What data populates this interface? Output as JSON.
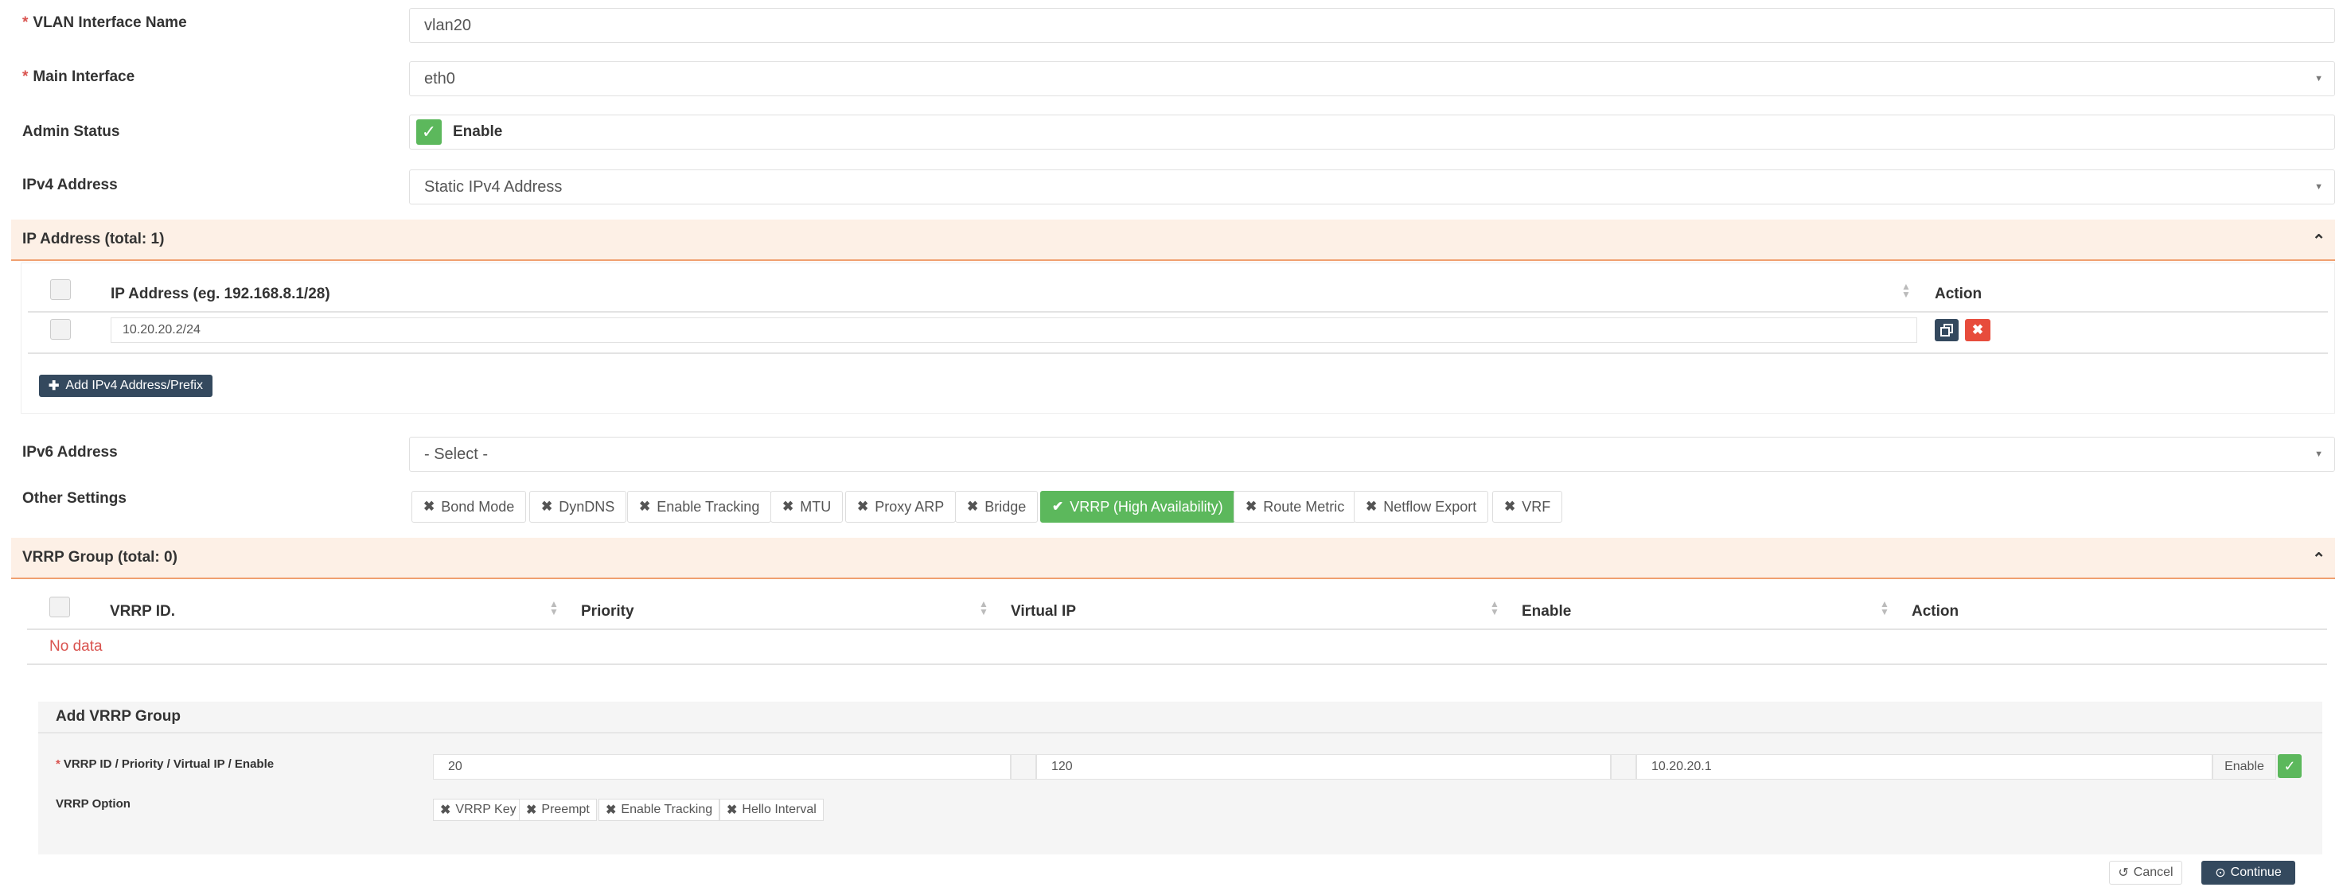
{
  "form": {
    "vlan_name_label": "VLAN Interface Name",
    "vlan_name_value": "vlan20",
    "main_interface_label": "Main Interface",
    "main_interface_value": "eth0",
    "admin_status_label": "Admin Status",
    "admin_status_value": "Enable",
    "ipv4_label": "IPv4 Address",
    "ipv4_value": "Static IPv4 Address",
    "ipv6_label": "IPv6 Address",
    "ipv6_value": "- Select -",
    "other_settings_label": "Other Settings",
    "required_mark": "*"
  },
  "ip_section": {
    "title": "IP Address (total: 1)",
    "col_ip": "IP Address (eg. 192.168.8.1/28)",
    "col_action": "Action",
    "rows": [
      {
        "ip": "10.20.20.2/24"
      }
    ],
    "add_button": "Add IPv4 Address/Prefix"
  },
  "other_settings": [
    {
      "label": "Bond Mode",
      "active": false
    },
    {
      "label": "DynDNS",
      "active": false
    },
    {
      "label": "Enable Tracking",
      "active": false
    },
    {
      "label": "MTU",
      "active": false
    },
    {
      "label": "Proxy ARP",
      "active": false
    },
    {
      "label": "Bridge",
      "active": false
    },
    {
      "label": "VRRP (High Availability)",
      "active": true
    },
    {
      "label": "Route Metric",
      "active": false
    },
    {
      "label": "Netflow Export",
      "active": false
    },
    {
      "label": "VRF",
      "active": false
    }
  ],
  "vrrp_section": {
    "title": "VRRP Group (total: 0)",
    "col_id": "VRRP ID.",
    "col_priority": "Priority",
    "col_vip": "Virtual IP",
    "col_enable": "Enable",
    "col_action": "Action",
    "empty_text": "No data"
  },
  "add_vrrp": {
    "title": "Add VRRP Group",
    "fields_label": "VRRP ID / Priority / Virtual IP / Enable",
    "vrrp_id": "20",
    "priority": "120",
    "virtual_ip": "10.20.20.1",
    "enable_label": "Enable",
    "option_label": "VRRP Option",
    "options": [
      "VRRP Key",
      "Preempt",
      "Enable Tracking",
      "Hello Interval"
    ]
  },
  "footer": {
    "cancel": "Cancel",
    "continue": "Continue"
  },
  "colors": {
    "accent_green": "#5cb85c",
    "danger_red": "#e74c3c",
    "dark_button": "#34495e",
    "section_bg": "#fdf0e6",
    "section_border": "#f0a070",
    "no_data": "#d9534f"
  }
}
